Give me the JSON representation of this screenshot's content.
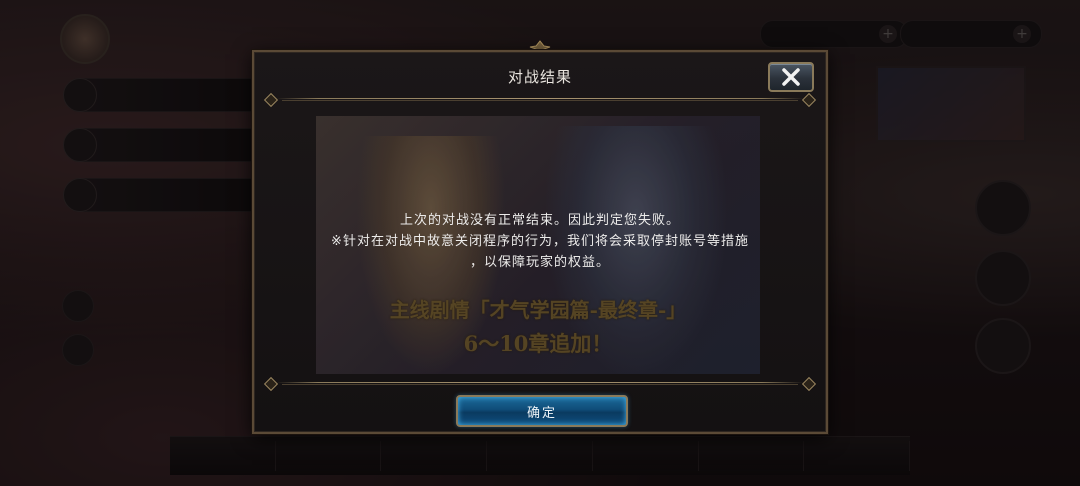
{
  "modal": {
    "title": "对战结果",
    "close_icon": "close-x-icon",
    "message_lines": [
      "上次的对战没有正常结束。因此判定您失败。",
      "※针对在对战中故意关闭程序的行为，我们将会采取停封账号等措施",
      "，以保障玩家的权益。"
    ],
    "ok_label": "确定",
    "background_art": {
      "promo_line1": "主线剧情「才气学园篇-最终章-」",
      "promo_line2": "6～10章追加！"
    }
  },
  "colors": {
    "modal_border": "#5b4a36",
    "ok_button_blue": "#0f4c78",
    "close_button_gray": "#3a444f",
    "text_white": "#ecebea"
  }
}
